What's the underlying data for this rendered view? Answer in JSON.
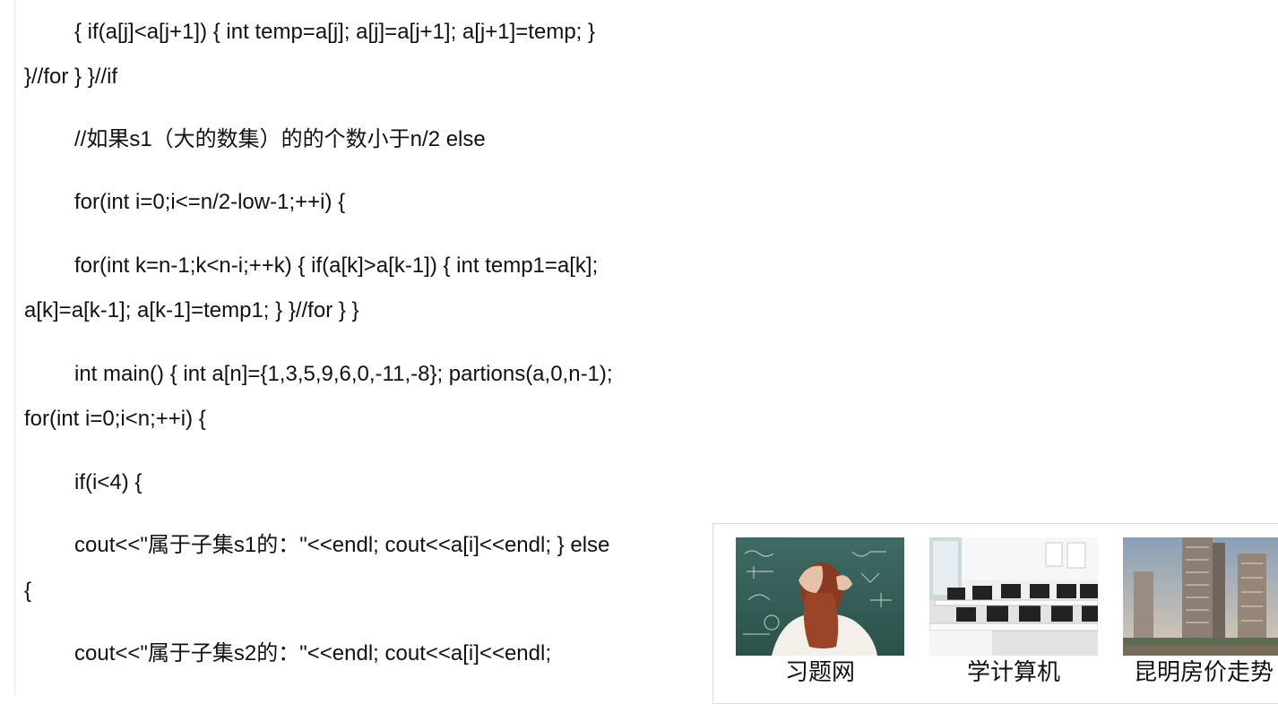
{
  "article": {
    "lines": [
      "{ if(a[j]<a[j+1]) { int temp=a[j]; a[j]=a[j+1]; a[j+1]=temp; }",
      "}//for } }//if",
      "//如果s1（大的数集）的的个数小于n/2 else",
      "for(int i=0;i<=n/2-low-1;++i) {",
      "for(int k=n-1;k<n-i;++k) { if(a[k]>a[k-1]) { int temp1=a[k];",
      "a[k]=a[k-1]; a[k-1]=temp1; } }//for } }",
      "int main() { int a[n]={1,3,5,9,6,0,-11,-8}; partions(a,0,n-1);",
      "for(int i=0;i<n;++i) {",
      "if(i<4) {",
      "cout<<\"属于子集s1的：\"<<endl; cout<<a[i]<<endl; } else",
      "{",
      "cout<<\"属于子集s2的：\"<<endl; cout<<a[i]<<endl;"
    ]
  },
  "recommendations": [
    {
      "label": "习题网",
      "thumb": "student-chalkboard-photo"
    },
    {
      "label": "学计算机",
      "thumb": "computer-lab-photo"
    },
    {
      "label": "昆明房价走势",
      "thumb": "highrise-buildings-photo"
    }
  ]
}
